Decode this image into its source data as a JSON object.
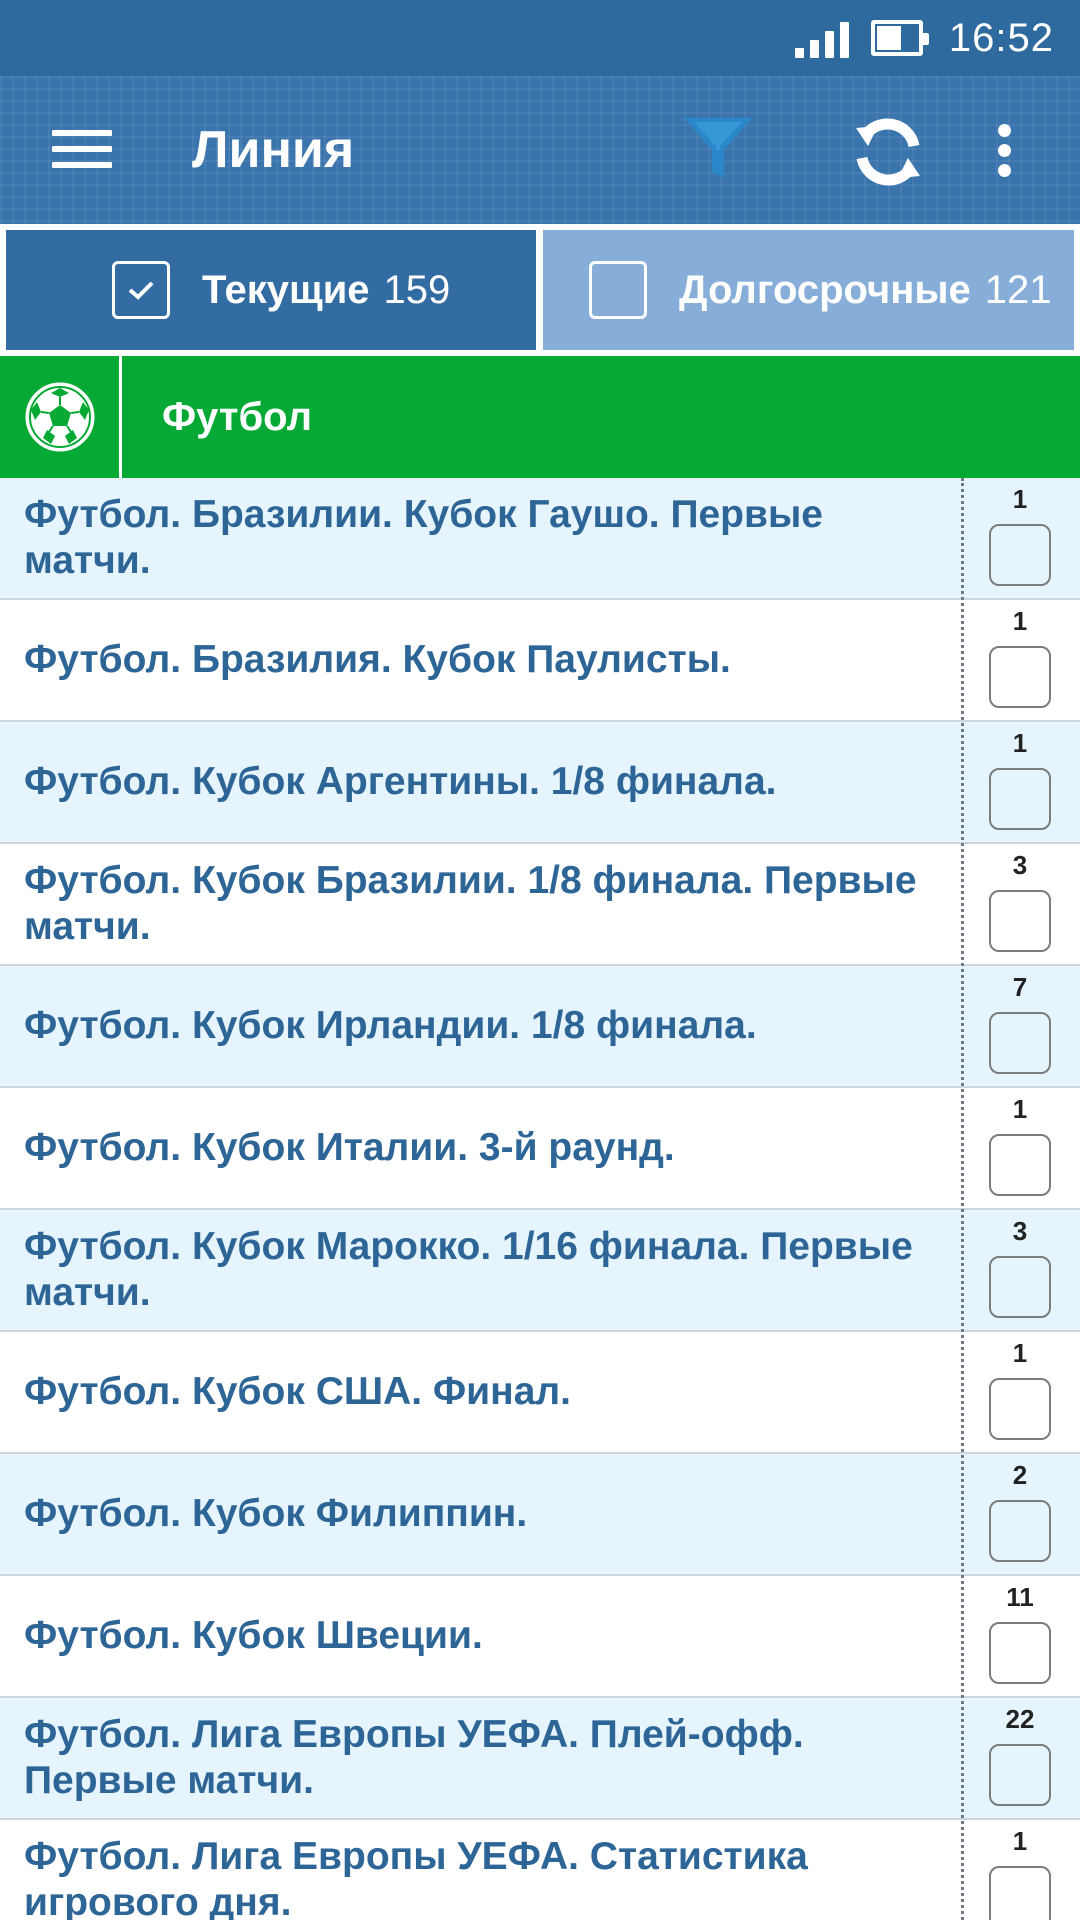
{
  "status_bar": {
    "time": "16:52",
    "signal_icon": "signal-icon",
    "battery_icon": "battery-icon"
  },
  "app_bar": {
    "title": "Линия",
    "menu_icon": "hamburger-menu-icon",
    "filter_icon": "filter-icon",
    "refresh_icon": "refresh-icon",
    "more_icon": "more-vert-icon",
    "colors": {
      "background": "#3a74ad",
      "filter": "#2a87c9"
    }
  },
  "tabs": {
    "current": {
      "label": "Текущие",
      "count": "159",
      "checked": true
    },
    "long_term": {
      "label": "Долгосрочные",
      "count": "121",
      "checked": false
    }
  },
  "sport": {
    "title": "Футбол",
    "icon": "soccer-ball-icon",
    "color": "#05a934"
  },
  "leagues": [
    {
      "name": "Футбол. Бразилии. Кубок Гаушо. Первые матчи.",
      "count": "1"
    },
    {
      "name": "Футбол. Бразилия. Кубок Паулисты.",
      "count": "1"
    },
    {
      "name": "Футбол. Кубок Аргентины. 1/8 финала.",
      "count": "1"
    },
    {
      "name": "Футбол. Кубок Бразилии. 1/8 финала. Первые матчи.",
      "count": "3"
    },
    {
      "name": "Футбол. Кубок Ирландии. 1/8 финала.",
      "count": "7"
    },
    {
      "name": "Футбол. Кубок Италии. 3-й раунд.",
      "count": "1"
    },
    {
      "name": "Футбол. Кубок Марокко. 1/16 финала. Первые матчи.",
      "count": "3"
    },
    {
      "name": "Футбол. Кубок США. Финал.",
      "count": "1"
    },
    {
      "name": "Футбол. Кубок Филиппин.",
      "count": "2"
    },
    {
      "name": "Футбол. Кубок Швеции.",
      "count": "11"
    },
    {
      "name": "Футбол. Лига Европы УЕФА. Плей-офф. Первые матчи.",
      "count": "22"
    },
    {
      "name": "Футбол. Лига Европы УЕФА. Статистика игрового дня.",
      "count": "1"
    }
  ]
}
